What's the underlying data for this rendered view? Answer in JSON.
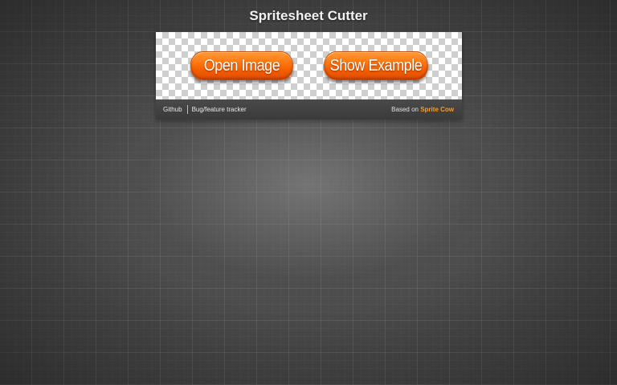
{
  "page": {
    "title": "Spritesheet Cutter"
  },
  "actions": {
    "open_image_label": "Open Image",
    "show_example_label": "Show Example"
  },
  "footer": {
    "github_label": "Github",
    "tracker_label": "Bug/feature tracker",
    "based_on_label": "Based on",
    "based_on_link": "Sprite Cow"
  },
  "colors": {
    "accent_orange": "#ff7a12",
    "link_orange": "#ff9b1f",
    "footer_bg": "#404040",
    "background": "#4a4a4a"
  }
}
